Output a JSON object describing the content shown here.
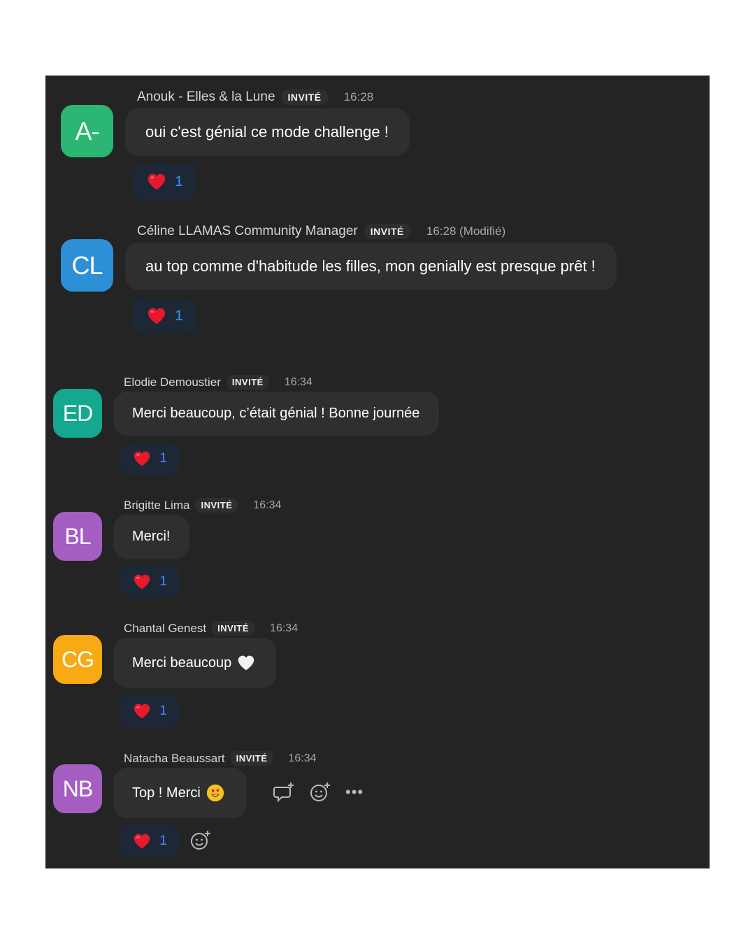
{
  "badge_label": "INVITÉ",
  "reaction_emoji": "heart-icon",
  "messages": [
    {
      "initials": "A-",
      "avatar_color": "#2bb673",
      "sender": "Anouk - Elles & la Lune",
      "time": "16:28",
      "text": "oui c'est génial ce mode challenge !",
      "reaction_count": "1"
    },
    {
      "initials": "CL",
      "avatar_color": "#2d8fd5",
      "sender": "Céline LLAMAS Community Manager",
      "time": "16:28 (Modifié)",
      "text": "au top comme d'habitude les filles, mon genially est presque prêt !",
      "reaction_count": "1"
    },
    {
      "initials": "ED",
      "avatar_color": "#14a88e",
      "sender": "Elodie Demoustier",
      "time": "16:34",
      "text": "Merci beaucoup, c’était génial ! Bonne journée",
      "reaction_count": "1"
    },
    {
      "initials": "BL",
      "avatar_color": "#a45dc1",
      "sender": "Brigitte Lima",
      "time": "16:34",
      "text": "Merci!",
      "reaction_count": "1"
    },
    {
      "initials": "CG",
      "avatar_color": "#f7aa14",
      "sender": "Chantal Genest",
      "time": "16:34",
      "text": "Merci beaucoup",
      "trailing_emoji": "white-heart-icon",
      "reaction_count": "1"
    },
    {
      "initials": "NB",
      "avatar_color": "#a45dc1",
      "sender": "Natacha Beaussart",
      "time": "16:34",
      "text": "Top ! Merci",
      "trailing_emoji": "heart-eyes-emoji",
      "reaction_count": "1",
      "hover_tools": [
        "reply-in-thread-icon",
        "add-reaction-icon",
        "more-options-icon"
      ]
    }
  ]
}
